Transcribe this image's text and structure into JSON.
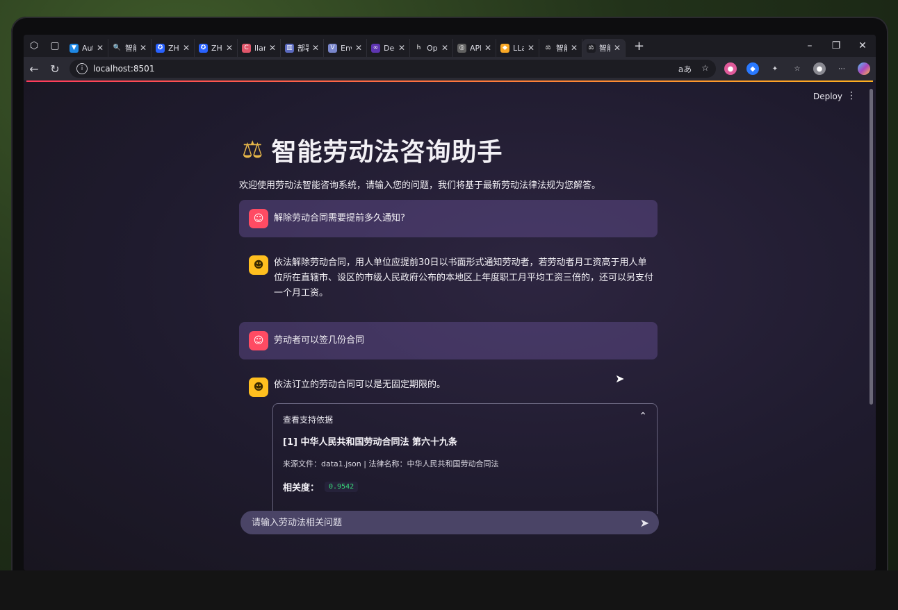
{
  "browser": {
    "tabs": [
      {
        "title": "Auto",
        "fav_color": "#1e88e5",
        "fav": "▼"
      },
      {
        "title": "智能",
        "fav_color": "#1c1c22",
        "fav": "🔍"
      },
      {
        "title": "ZHIP",
        "fav_color": "#2962ff",
        "fav": "✪"
      },
      {
        "title": "ZHIP",
        "fav_color": "#2962ff",
        "fav": "✪"
      },
      {
        "title": "llam",
        "fav_color": "#e0566a",
        "fav": "C"
      },
      {
        "title": "部署",
        "fav_color": "#5c6bc0",
        "fav": "▥"
      },
      {
        "title": "Envir",
        "fav_color": "#7986cb",
        "fav": "V"
      },
      {
        "title": "Deep",
        "fav_color": "#5e35b1",
        "fav": "∞"
      },
      {
        "title": "Oper",
        "fav_color": "#1c1c22",
        "fav": "h"
      },
      {
        "title": "API",
        "fav_color": "#616161",
        "fav": "◎"
      },
      {
        "title": "LLaN",
        "fav_color": "#f9a825",
        "fav": "◆"
      },
      {
        "title": "智能",
        "fav_color": "#1c1c22",
        "fav": "⚖"
      },
      {
        "title": "智能",
        "fav_color": "#1c1c22",
        "fav": "⚖"
      }
    ],
    "url": "localhost:8501",
    "url_right_label": "aあ"
  },
  "app": {
    "deploy_label": "Deploy",
    "title": "智能劳动法咨询助手",
    "intro": "欢迎使用劳动法智能咨询系统，请输入您的问题，我们将基于最新劳动法律法规为您解答。",
    "messages": [
      {
        "role": "user",
        "text": "解除劳动合同需要提前多久通知?"
      },
      {
        "role": "assistant",
        "text": "依法解除劳动合同，用人单位应提前30日以书面形式通知劳动者，若劳动者月工资高于用人单位所在直辖市、设区的市级人民政府公布的本地区上年度职工月平均工资三倍的，还可以另支付一个月工资。"
      },
      {
        "role": "user",
        "text": "劳动者可以签几份合同"
      },
      {
        "role": "assistant",
        "text": "依法订立的劳动合同可以是无固定期限的。"
      }
    ],
    "support": {
      "header": "查看支持依据",
      "law_title": "[1] 中华人民共和国劳动合同法 第六十九条",
      "source": "来源文件：data1.json | 法律名称：中华人民共和国劳动合同法",
      "relevance_label": "相关度：",
      "relevance_value": "0.9542"
    },
    "input_placeholder": "请输入劳动法相关问题"
  }
}
